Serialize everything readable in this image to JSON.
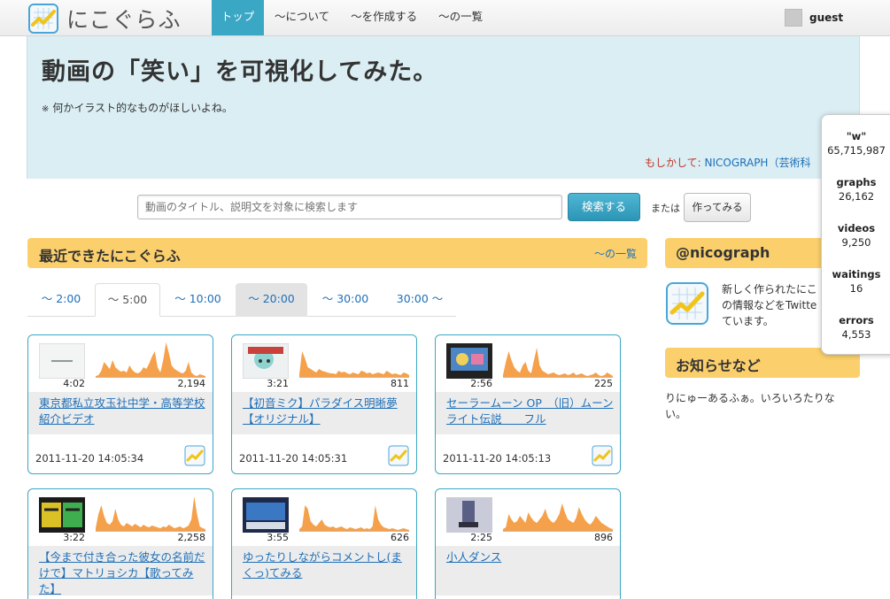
{
  "header": {
    "logo_text": "にこぐらふ",
    "nav": [
      "トップ",
      "〜について",
      "〜を作成する",
      "〜の一覧"
    ],
    "user_name": "guest"
  },
  "hero": {
    "title": "動画の「笑い」を可視化してみた。",
    "note_mark": "※",
    "note": "何かイラスト的なものがほしいよね。",
    "suggest_prefix": "もしかして: ",
    "suggest_link": "NICOGRAPH（芸術科"
  },
  "search": {
    "placeholder": "動画のタイトル、説明文を対象に検索します",
    "button": "検索する",
    "or": "または",
    "make_button": "作ってみる"
  },
  "recent": {
    "title": "最近できたにこぐらふ",
    "list_link": "〜の一覧",
    "tabs": [
      "〜 2:00",
      "〜 5:00",
      "〜 10:00",
      "〜 20:00",
      "〜 30:00",
      "30:00 〜"
    ]
  },
  "cards": [
    {
      "duration": "4:02",
      "views": "2,194",
      "title": "東京都私立攻玉社中学・高等学校紹介ビデオ",
      "date": "2011-11-20 14:05:34",
      "spark": [
        2,
        3,
        8,
        18,
        14,
        10,
        20,
        12,
        9,
        7,
        8,
        6,
        14,
        9,
        6,
        5,
        7,
        12,
        10,
        16,
        24,
        30,
        12,
        6,
        20,
        40,
        28,
        14,
        10,
        8,
        6,
        5,
        8,
        18,
        6,
        3,
        2,
        4,
        3,
        2
      ]
    },
    {
      "duration": "3:21",
      "views": "811",
      "title": "【初音ミク】パラダイス明晰夢【オリジナル】",
      "date": "2011-11-20 14:05:31",
      "spark": [
        4,
        30,
        22,
        12,
        10,
        8,
        6,
        10,
        8,
        7,
        6,
        5,
        5,
        4,
        8,
        6,
        7,
        5,
        4,
        6,
        5,
        4,
        8,
        7,
        5,
        6,
        4,
        5,
        6,
        5,
        4,
        8,
        6,
        4,
        5,
        4,
        3,
        6,
        5,
        3
      ]
    },
    {
      "duration": "2:56",
      "views": "225",
      "title": "セーラームーン OP　（旧）ムーンライト伝説　　フル",
      "date": "2011-11-20 14:05:13",
      "spark": [
        3,
        18,
        30,
        20,
        12,
        8,
        6,
        14,
        18,
        8,
        5,
        20,
        34,
        14,
        8,
        6,
        4,
        5,
        6,
        4,
        3,
        4,
        5,
        3,
        4,
        6,
        3,
        4,
        5,
        3,
        2,
        3,
        4,
        6,
        3,
        2,
        3,
        6,
        4,
        2
      ]
    },
    {
      "duration": "3:22",
      "views": "2,258",
      "title": "【今まで付き合った彼女の名前だけで】マトリョシカ【歌ってみた】",
      "date": "",
      "spark": [
        4,
        20,
        30,
        18,
        10,
        8,
        12,
        26,
        14,
        8,
        6,
        10,
        8,
        6,
        9,
        7,
        5,
        8,
        6,
        5,
        7,
        6,
        5,
        4,
        6,
        5,
        8,
        6,
        4,
        5,
        6,
        4,
        5,
        7,
        14,
        40,
        20,
        6,
        4,
        3
      ]
    },
    {
      "duration": "3:55",
      "views": "626",
      "title": "ゆったりしながらコメントし(まくっ)てみる",
      "date": "",
      "spark": [
        3,
        6,
        30,
        26,
        12,
        8,
        6,
        10,
        14,
        8,
        6,
        5,
        6,
        4,
        5,
        6,
        4,
        3,
        5,
        4,
        3,
        4,
        5,
        3,
        4,
        3,
        6,
        30,
        14,
        8,
        5,
        4,
        3,
        4,
        3,
        2,
        3,
        4,
        3,
        2
      ]
    },
    {
      "duration": "2:25",
      "views": "896",
      "title": "小人ダンス",
      "date": "",
      "spark": [
        3,
        5,
        20,
        14,
        10,
        12,
        18,
        14,
        10,
        22,
        16,
        12,
        10,
        14,
        18,
        26,
        16,
        12,
        10,
        14,
        20,
        32,
        22,
        14,
        12,
        10,
        16,
        28,
        20,
        14,
        10,
        8,
        12,
        18,
        14,
        10,
        8,
        6,
        4,
        3
      ]
    }
  ],
  "sidebar": {
    "twitter_title": "@nicograph",
    "twitter_text": "新しく作られたにこ の情報などをTwitte ています。",
    "notice_title": "お知らせなど",
    "notice_text": "りにゅーあるふぁ。いろいろたりない。"
  },
  "stats": [
    {
      "label": "\"w\"",
      "value": "65,715,987"
    },
    {
      "label": "graphs",
      "value": "26,162"
    },
    {
      "label": "videos",
      "value": "9,250"
    },
    {
      "label": "waitings",
      "value": "16"
    },
    {
      "label": "errors",
      "value": "4,553"
    }
  ],
  "colors": {
    "accent": "#3aa7c5",
    "section_header": "#fbd06c",
    "hero_bg": "#daeef3",
    "spark_fill": "#f5a04a",
    "link": "#1f6fb8"
  }
}
